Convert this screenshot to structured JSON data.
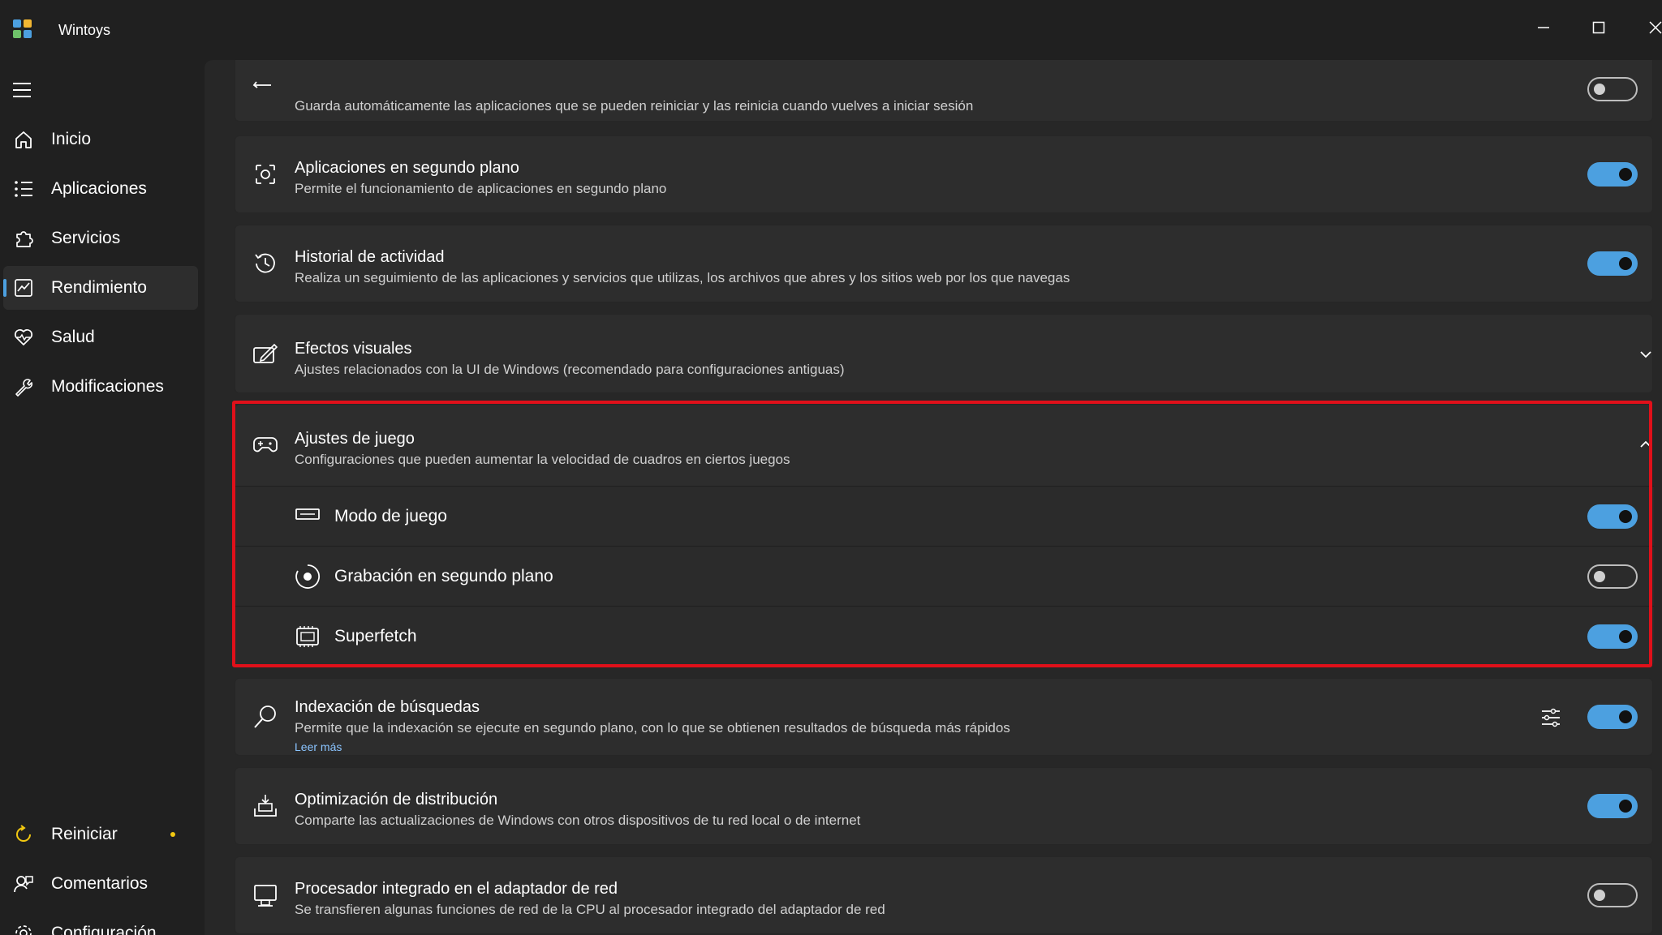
{
  "window": {
    "title": "Wintoys",
    "logo_colors": [
      "#4ca0e0",
      "#f2b632",
      "#e8552d",
      "#6fc26a"
    ]
  },
  "sidebar": {
    "menu_icon": "hamburger-icon",
    "items": [
      {
        "label": "Inicio",
        "icon": "home-icon"
      },
      {
        "label": "Aplicaciones",
        "icon": "list-icon"
      },
      {
        "label": "Servicios",
        "icon": "puzzle-icon"
      },
      {
        "label": "Rendimiento",
        "icon": "performance-chart-icon",
        "active": true
      },
      {
        "label": "Salud",
        "icon": "heart-pulse-icon"
      },
      {
        "label": "Modificaciones",
        "icon": "wrench-icon"
      }
    ],
    "bottom_items": [
      {
        "label": "Reiniciar",
        "icon": "restart-icon",
        "badge_color": "#f2c811"
      },
      {
        "label": "Comentarios",
        "icon": "feedback-icon"
      },
      {
        "label": "Configuración",
        "icon": "gear-icon"
      }
    ]
  },
  "settings": [
    {
      "title": "",
      "desc": "Guarda automáticamente las aplicaciones que se pueden reiniciar y las reinicia cuando vuelves a iniciar sesión",
      "icon": "restart-apps-icon",
      "toggle": "off"
    },
    {
      "title": "Aplicaciones en segundo plano",
      "desc": "Permite el funcionamiento de aplicaciones en segundo plano",
      "icon": "background-apps-icon",
      "toggle": "on"
    },
    {
      "title": "Historial de actividad",
      "desc": "Realiza un seguimiento de las aplicaciones y servicios que utilizas, los archivos que abres y los sitios web por los que navegas",
      "icon": "history-icon",
      "toggle": "on"
    },
    {
      "title": "Efectos visuales",
      "desc": "Ajustes relacionados con la UI de Windows (recomendado para configuraciones antiguas)",
      "icon": "visual-effects-icon",
      "control": "chevron-down"
    },
    {
      "title": "Ajustes de juego",
      "desc": "Configuraciones que pueden aumentar la velocidad de cuadros en ciertos juegos",
      "icon": "gamepad-icon",
      "control": "chevron-up",
      "children": [
        {
          "label": "Modo de juego",
          "icon": "game-mode-icon",
          "toggle": "on"
        },
        {
          "label": "Grabación en segundo plano",
          "icon": "record-icon",
          "toggle": "off"
        },
        {
          "label": "Superfetch",
          "icon": "memory-chip-icon",
          "toggle": "on"
        }
      ]
    },
    {
      "title": "Indexación de búsquedas",
      "desc": "Permite que la indexación se ejecute en segundo plano, con lo que se obtienen resultados de búsqueda más rápidos",
      "link": "Leer más",
      "icon": "search-icon",
      "extra_icon": "sliders-icon",
      "toggle": "on"
    },
    {
      "title": "Optimización de distribución",
      "desc": "Comparte las actualizaciones de Windows con otros dispositivos de tu red local o de internet",
      "icon": "delivery-optimization-icon",
      "toggle": "on"
    },
    {
      "title": "Procesador integrado en el adaptador de red",
      "desc": "Se transfieren algunas funciones de red de la CPU al procesador integrado del adaptador de red",
      "icon": "network-adapter-icon",
      "toggle": "off"
    }
  ],
  "highlight_color": "#e0101a",
  "accent_color": "#4ca0e0"
}
